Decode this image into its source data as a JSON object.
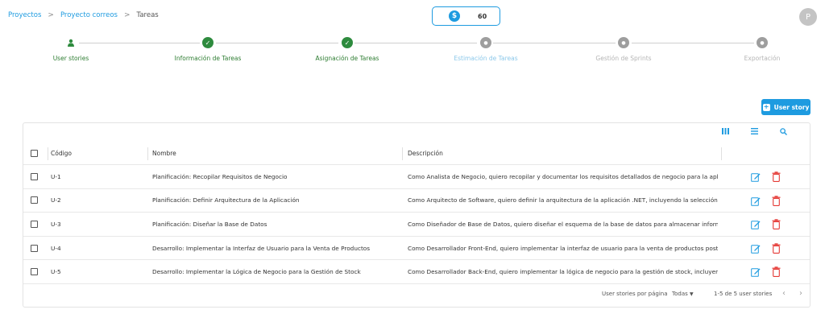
{
  "breadcrumb": {
    "items": [
      "Proyectos",
      "Proyecto correos"
    ],
    "current": "Tareas",
    "separator": ">"
  },
  "credits": {
    "icon": "dollar-coin-icon",
    "value": "60"
  },
  "avatar": {
    "initial": "P"
  },
  "stepper": {
    "steps": [
      {
        "label": "User stories",
        "state": "current",
        "icon": "person-icon"
      },
      {
        "label": "Información de Tareas",
        "state": "done",
        "icon": "check-icon"
      },
      {
        "label": "Asignación de Tareas",
        "state": "done",
        "icon": "check-icon"
      },
      {
        "label": "Estimación de Tareas",
        "state": "next",
        "icon": "dot-icon"
      },
      {
        "label": "Gestión de Sprints",
        "state": "todo",
        "icon": "dot-icon"
      },
      {
        "label": "Exportación",
        "state": "todo",
        "icon": "dot-icon"
      }
    ]
  },
  "add_button": {
    "label": "User story",
    "icon": "plus-square-icon"
  },
  "table": {
    "columns": [
      "Código",
      "Nombre",
      "Descripción"
    ],
    "rows": [
      {
        "code": "U-1",
        "name": "Planificación: Recopilar Requisitos de Negocio",
        "description": "Como Analista de Negocio, quiero recopilar y documentar los requisitos detallados de negocio para la aplica..."
      },
      {
        "code": "U-2",
        "name": "Planificación: Definir Arquitectura de la Aplicación",
        "description": "Como Arquitecto de Software, quiero definir la arquitectura de la aplicación .NET, incluyendo la selección de fr..."
      },
      {
        "code": "U-3",
        "name": "Planificación: Diseñar la Base de Datos",
        "description": "Como Diseñador de Base de Datos, quiero diseñar el esquema de la base de datos para almacenar informaci..."
      },
      {
        "code": "U-4",
        "name": "Desarrollo: Implementar la Interfaz de Usuario para la Venta de Productos",
        "description": "Como Desarrollador Front-End, quiero implementar la interfaz de usuario para la venta de productos postales ..."
      },
      {
        "code": "U-5",
        "name": "Desarrollo: Implementar la Lógica de Negocio para la Gestión de Stock",
        "description": "Como Desarrollador Back-End, quiero implementar la lógica de negocio para la gestión de stock, incluyendo l..."
      }
    ]
  },
  "footer": {
    "rows_per_page_label": "User stories por página",
    "rows_per_page_value": "Todas",
    "range_text": "1-5 de 5 user stories"
  },
  "colors": {
    "accent": "#1e9be0",
    "done": "#2e8b3e",
    "todo": "#9e9e9e",
    "edit": "#1e9be0",
    "delete": "#e53935"
  }
}
